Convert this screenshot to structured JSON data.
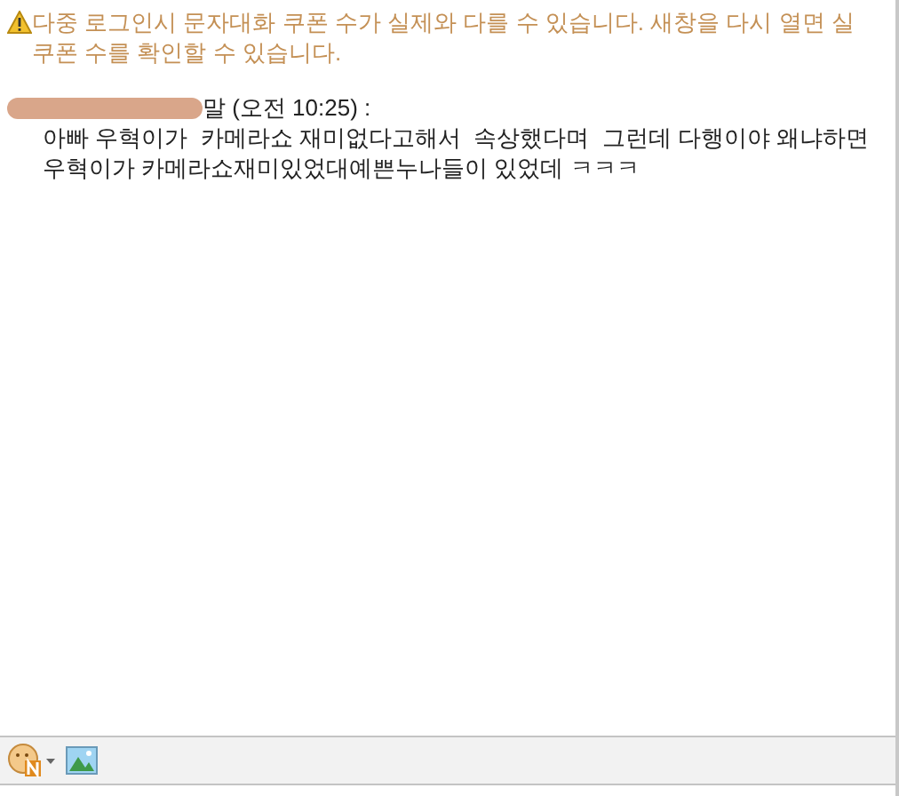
{
  "notice": {
    "text": "다중 로그인시 문자대화 쿠폰 수가 실제와 다를 수 있습니다. 새창을 다시 열면 실 쿠폰 수를 확인할 수 있습니다."
  },
  "messages": [
    {
      "sender": "말 (오전 10:25) :",
      "body": "아빠 우혁이가  카메라쇼 재미없다고해서  속상했다며  그런데 다행이야 왜냐하면우혁이가 카메라쇼재미있었대예쁜누나들이 있었데 ㅋㅋㅋ"
    }
  ]
}
